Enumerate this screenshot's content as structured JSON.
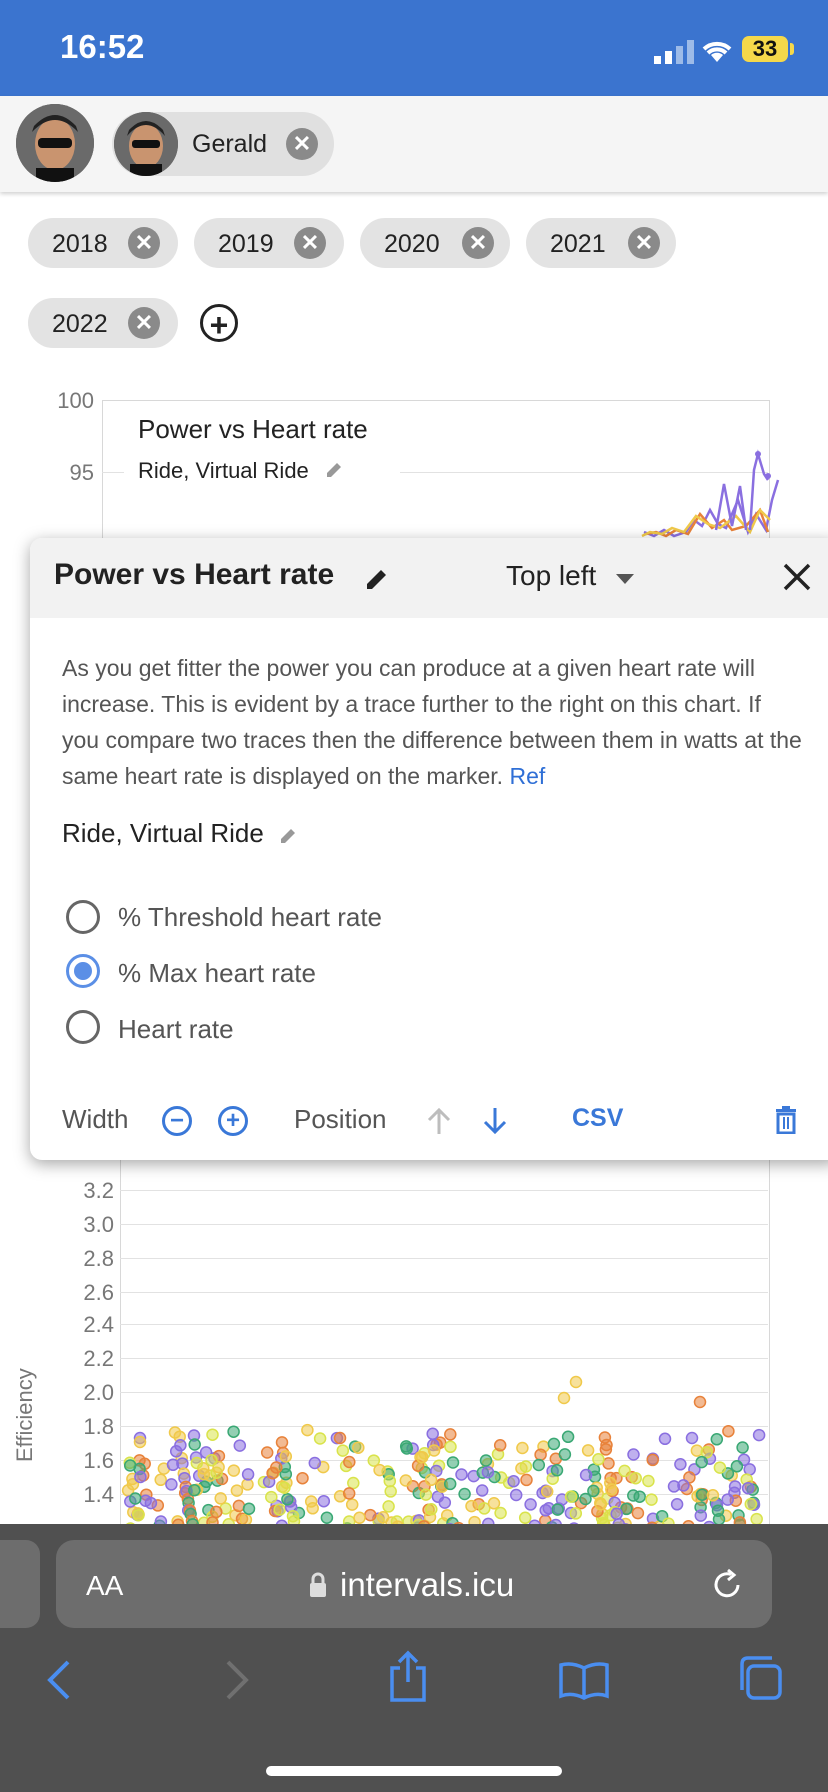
{
  "status_bar": {
    "time": "16:52",
    "battery": "33"
  },
  "athlete": {
    "name": "Gerald"
  },
  "years": [
    "2018",
    "2019",
    "2020",
    "2021",
    "2022"
  ],
  "chart_top": {
    "title": "Power vs Heart rate",
    "subtitle": "Ride, Virtual Ride",
    "y_ticks": [
      "100",
      "95"
    ]
  },
  "popup": {
    "title": "Power vs Heart rate",
    "position": "Top left",
    "description": "As you get fitter the power you can produce at a given heart rate will increase. This is evident by a trace further to the right on this chart. If you compare two traces then the difference between them in watts at the same heart rate is displayed on the marker.",
    "ref_link": "Ref",
    "sports": "Ride, Virtual Ride",
    "radios": [
      {
        "label": "% Threshold heart rate",
        "selected": false
      },
      {
        "label": "% Max heart rate",
        "selected": true
      },
      {
        "label": "Heart rate",
        "selected": false
      }
    ],
    "width_label": "Width",
    "position_label": "Position",
    "csv_label": "CSV"
  },
  "chart_bottom": {
    "ylabel": "Efficiency",
    "y_ticks": [
      "3.2",
      "3.0",
      "2.8",
      "2.6",
      "2.4",
      "2.2",
      "2.0",
      "1.8",
      "1.6",
      "1.4"
    ]
  },
  "browser": {
    "aa": "AA",
    "url": "intervals.icu"
  },
  "colors": {
    "status_bar": "#3b74cf",
    "accent": "#3a78d8",
    "series": [
      "#8a6fe0",
      "#e8823a",
      "#f0c94a",
      "#d9e34a",
      "#3aa874"
    ]
  }
}
